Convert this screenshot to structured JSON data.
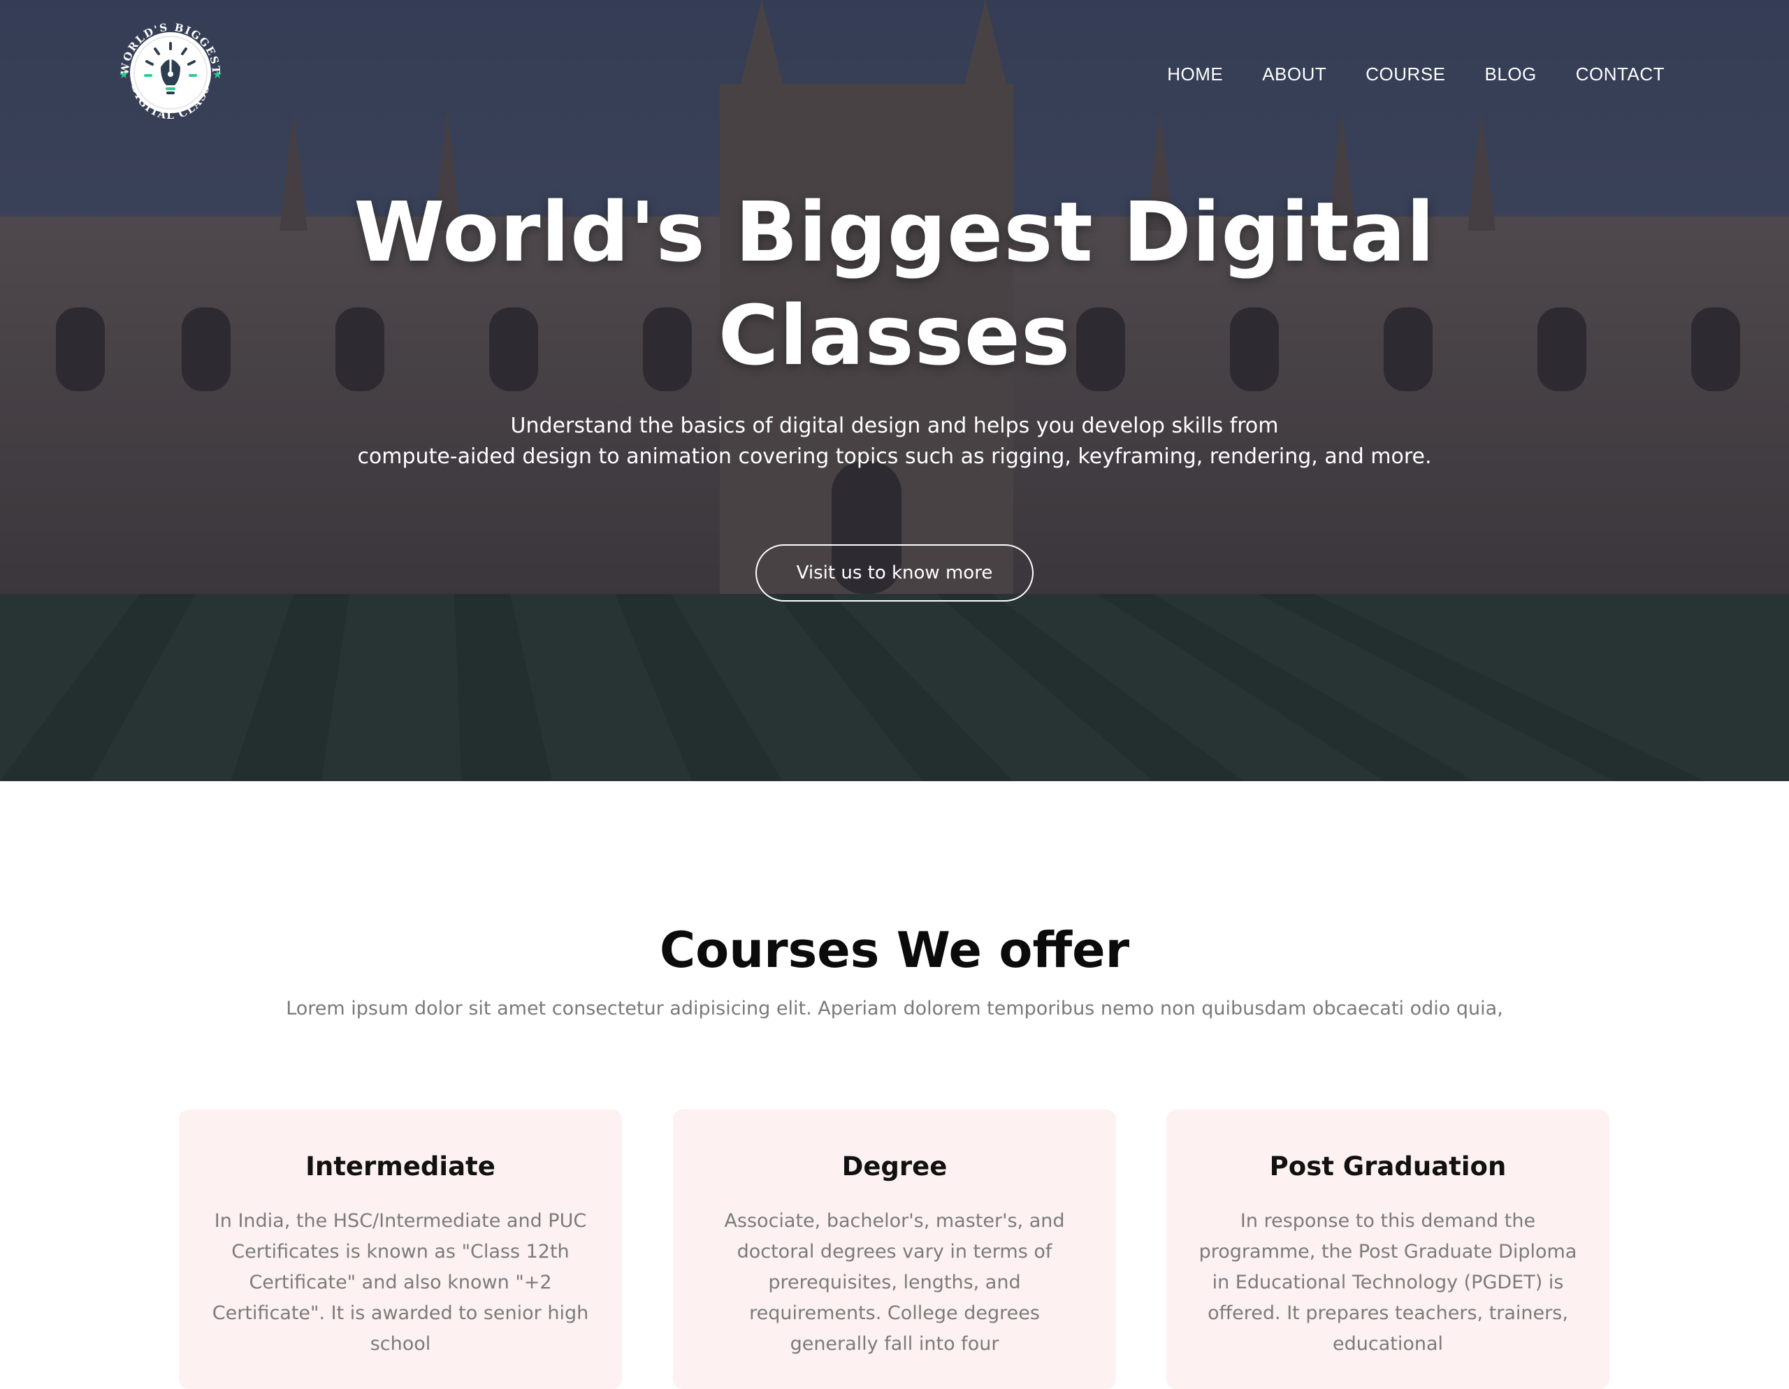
{
  "brand": {
    "logo_text_top": "WORLD'S BIGGEST",
    "logo_text_bottom": "DIGITAL CLASS",
    "accent_color": "#2ecc8f"
  },
  "nav": {
    "items": [
      {
        "label": "HOME"
      },
      {
        "label": "ABOUT"
      },
      {
        "label": "COURSE"
      },
      {
        "label": "BLOG"
      },
      {
        "label": "CONTACT"
      }
    ]
  },
  "hero": {
    "title_line1": "World's Biggest Digital",
    "title_line2": "Classes",
    "subtitle_line1": "Understand the basics of digital design and helps you develop skills from",
    "subtitle_line2": "compute-aided design to animation covering topics such as rigging, keyframing, rendering, and more.",
    "cta_label": "Visit us to know more"
  },
  "courses": {
    "title": "Courses We offer",
    "subtitle": "Lorem ipsum dolor sit amet consectetur adipisicing elit. Aperiam dolorem temporibus nemo non quibusdam obcaecati odio quia,",
    "cards": [
      {
        "title": "Intermediate",
        "text": "In India, the HSC/Intermediate and PUC Certificates is known as \"Class 12th Certificate\" and also known \"+2 Certificate\". It is awarded to senior high school"
      },
      {
        "title": "Degree",
        "text": "Associate, bachelor's, master's, and doctoral degrees vary in terms of prerequisites, lengths, and requirements. College degrees generally fall into four"
      },
      {
        "title": "Post Graduation",
        "text": "In response to this demand the programme, the Post Graduate Diploma in Educational Technology (PGDET) is offered. It prepares teachers, trainers, educational"
      }
    ]
  }
}
